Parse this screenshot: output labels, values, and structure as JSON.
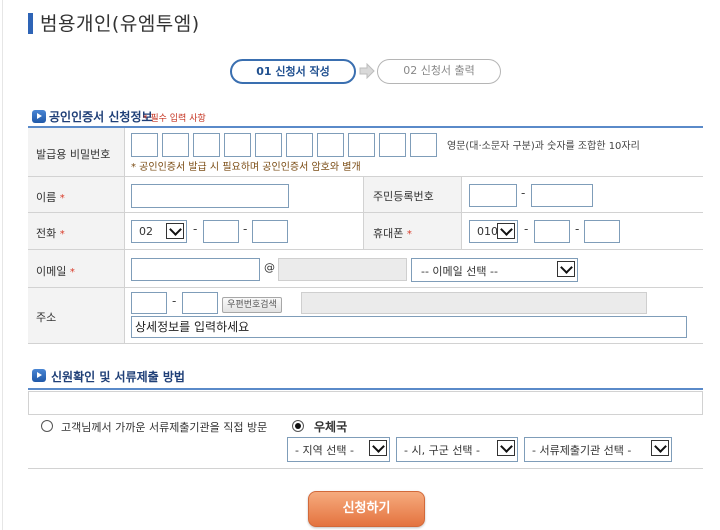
{
  "page_title": "범용개인(유엠투엠)",
  "steps": {
    "step1": "01 신청서 작성",
    "step2": "02 신청서 출력"
  },
  "section1": {
    "title": "공인인증서 신청정보",
    "required_note": "* 필수 입력 사항"
  },
  "fields": {
    "password": {
      "label": "발급용 비밀번호",
      "help": "영문(대·소문자 구분)과 숫자를 조합한 10자리",
      "note": "* 공인인증서 발급 시 필요하며 공인인증서 암호와 별개"
    },
    "name": {
      "label": "이름"
    },
    "rrn": {
      "label": "주민등록번호"
    },
    "phone": {
      "label": "전화",
      "area_code": "02"
    },
    "mobile": {
      "label": "휴대폰",
      "prefix": "010"
    },
    "email": {
      "label": "이메일",
      "at": "@",
      "select": "-- 이메일 선택 --"
    },
    "address": {
      "label": "주소",
      "zip_button": "우편번호검색",
      "detail_placeholder": "상세정보를 입력하세요"
    }
  },
  "section2": {
    "title": "신원확인 및 서류제출 방법",
    "option_visit": "고객님께서 가까운 서류제출기관을 직접 방문",
    "option_post": "우체국",
    "select_region": "- 지역 선택 -",
    "select_city": "- 시, 구군 선택 -",
    "select_agency": "- 서류제출기관 선택 -"
  },
  "submit_label": "신청하기",
  "required_mark": "*"
}
